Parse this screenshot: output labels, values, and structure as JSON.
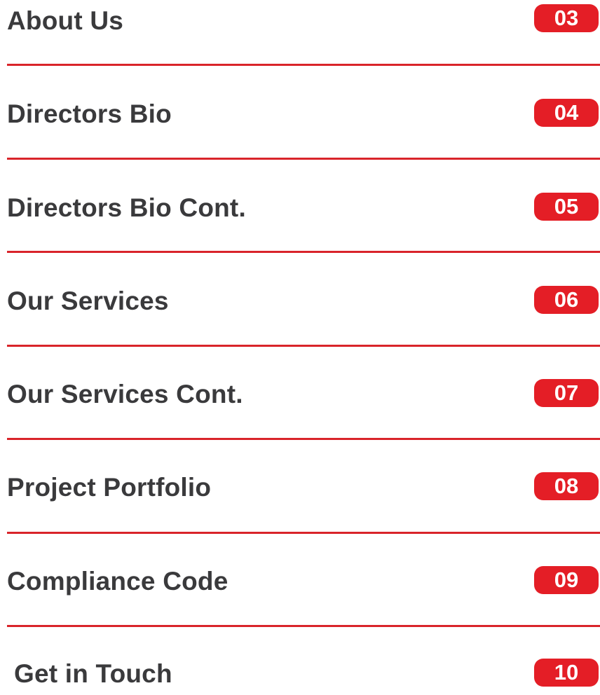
{
  "toc": {
    "accent_color": "#e41e26",
    "text_color": "#3a3a3c",
    "items": [
      {
        "title": "About Us",
        "page": "03"
      },
      {
        "title": "Directors Bio",
        "page": "04"
      },
      {
        "title": "Directors Bio Cont.",
        "page": "05"
      },
      {
        "title": "Our Services",
        "page": "06"
      },
      {
        "title": "Our Services Cont.",
        "page": "07"
      },
      {
        "title": "Project Portfolio",
        "page": "08"
      },
      {
        "title": "Compliance Code",
        "page": "09"
      },
      {
        "title": "Get in Touch",
        "page": "10"
      }
    ]
  }
}
